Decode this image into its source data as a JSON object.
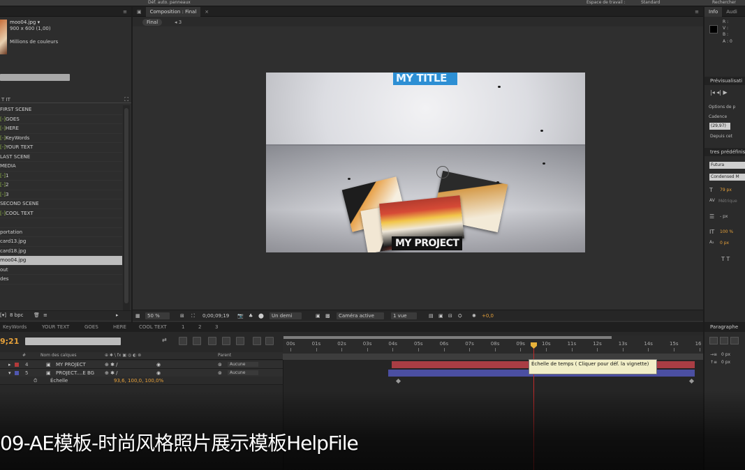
{
  "topbar": {
    "options_label": "Déf. auto. panneaux",
    "workspace_label": "Espace de travail :",
    "workspace_value": "Standard",
    "search_label": "Rechercher"
  },
  "project": {
    "file_name": "moo04.jpg ▾",
    "file_dimensions": "900 x 600 (1,00)",
    "file_colors": "Millions de couleurs",
    "list_header": "T IT",
    "items": [
      {
        "prefix": "",
        "label": "FIRST SCENE"
      },
      {
        "prefix": "[-]",
        "label": "GOES"
      },
      {
        "prefix": "[-]",
        "label": "HERE"
      },
      {
        "prefix": "[-]",
        "label": "KeyWords"
      },
      {
        "prefix": "[-]",
        "label": "YOUR TEXT"
      },
      {
        "prefix": "",
        "label": "LAST SCENE"
      },
      {
        "prefix": "",
        "label": "MEDIA"
      },
      {
        "prefix": "[-]",
        "label": "1"
      },
      {
        "prefix": "[-]",
        "label": "2"
      },
      {
        "prefix": "[-]",
        "label": "3"
      },
      {
        "prefix": "",
        "label": "SECOND SCENE"
      },
      {
        "prefix": "[-]",
        "label": "COOL TEXT"
      },
      {
        "prefix": "",
        "label": ""
      },
      {
        "prefix": "",
        "label": "portation"
      },
      {
        "prefix": "",
        "label": "card13.jpg"
      },
      {
        "prefix": "",
        "label": "card18.jpg"
      },
      {
        "prefix": "",
        "label": "moo04.jpg",
        "selected": true
      },
      {
        "prefix": "",
        "label": "out"
      },
      {
        "prefix": "",
        "label": "des"
      }
    ],
    "bpc_label": "8 bpc"
  },
  "composition": {
    "tab_label": "Composition : Final",
    "breadcrumb": "Final",
    "breadcrumb_num": "3",
    "viewer_title": "MY TITLE",
    "viewer_bottom": "MY PROJECT",
    "zoom": "50 %",
    "timecode": "0;00;09;19",
    "resolution": "Un demi",
    "camera": "Caméra active",
    "views": "1 vue",
    "exposure": "+0,0"
  },
  "info": {
    "tab_info": "Info",
    "tab_audio": "Audi",
    "r": "R :",
    "v": "V :",
    "b": "B :",
    "a": "A : 0",
    "preview_header": "Prévisualisati",
    "preview_options": "Options de p",
    "cadence_label": "Cadence",
    "cadence_value": "(29,97)",
    "depuis_label": "Depuis cet",
    "presets_header": "tres prédéfinis",
    "font_name": "Futura",
    "font_style": "Condensed M",
    "font_size": "79 px",
    "metrics": "Métrique",
    "leading": "- px",
    "scale": "100 %",
    "baseline": "0 px"
  },
  "timeline": {
    "tabs": [
      "KeyWords",
      "YOUR TEXT",
      "GOES",
      "HERE",
      "COOL TEXT",
      "1",
      "2",
      "3"
    ],
    "current_time": "9;21",
    "col_name": "Nom des calques",
    "col_parent": "Parent",
    "layers": [
      {
        "num": "4",
        "color": "#b33a3a",
        "name": "MY PROJECT",
        "parent": "Aucune"
      },
      {
        "num": "5",
        "color": "#5057b0",
        "name": "PROJECT....E BG",
        "parent": "Aucune"
      }
    ],
    "property_name": "Échelle",
    "property_value": "93,6, 100,0, 100,0%",
    "ruler_ticks": [
      "00s",
      "01s",
      "02s",
      "03s",
      "04s",
      "05s",
      "06s",
      "07s",
      "08s",
      "09s",
      "10s",
      "11s",
      "12s",
      "13s",
      "14s",
      "15s",
      "16"
    ],
    "tooltip": "Échelle de temps ( Cliquer pour déf. la vignette)"
  },
  "paragraph": {
    "header": "Paragraphe",
    "indent1": "0 px",
    "indent2": "0 px"
  },
  "caption": "09-AE模板-时尚风格照片展示模板HelpFile"
}
